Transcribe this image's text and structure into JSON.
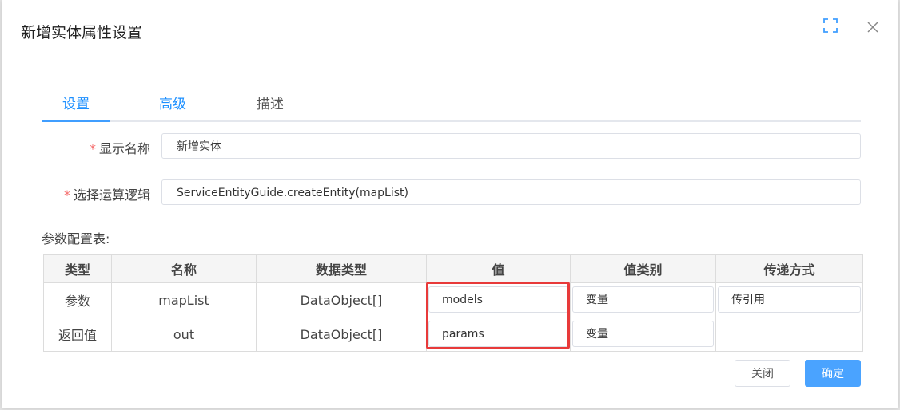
{
  "dialog": {
    "title": "新增实体属性设置",
    "icons": {
      "fullscreen": "fullscreen-icon",
      "close": "close-icon"
    }
  },
  "tabs": [
    {
      "label": "设置",
      "active": true
    },
    {
      "label": "高级",
      "active": false
    },
    {
      "label": "描述",
      "active": false
    }
  ],
  "form": {
    "display_name": {
      "required_mark": "*",
      "label": "显示名称",
      "value": "新增实体"
    },
    "logic": {
      "required_mark": "*",
      "label": "选择运算逻辑",
      "value": "ServiceEntityGuide.createEntity(mapList)"
    }
  },
  "params": {
    "label": "参数配置表:",
    "columns": [
      "类型",
      "名称",
      "数据类型",
      "值",
      "值类别",
      "传递方式"
    ],
    "rows": [
      {
        "type": "参数",
        "name": "mapList",
        "data_type": "DataObject[]",
        "value": "models",
        "value_kind": "变量",
        "pass_mode": "传引用"
      },
      {
        "type": "返回值",
        "name": "out",
        "data_type": "DataObject[]",
        "value": "params",
        "value_kind": "变量",
        "pass_mode": ""
      }
    ]
  },
  "buttons": {
    "close": "关闭",
    "ok": "确定"
  },
  "colors": {
    "accent": "#409eff",
    "primary_button": "#4aa3ff",
    "highlight": "#e83a3a",
    "required": "#f56c6c"
  }
}
